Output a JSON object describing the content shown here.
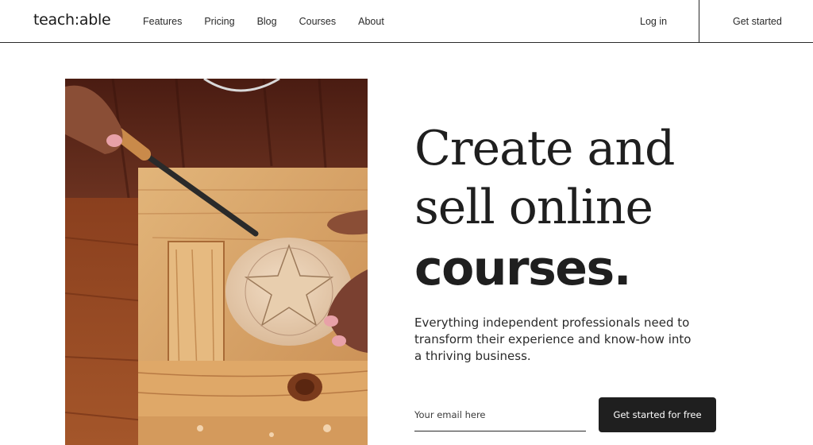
{
  "header": {
    "logo": "teach:able",
    "nav": [
      "Features",
      "Pricing",
      "Blog",
      "Courses",
      "About"
    ],
    "login": "Log in",
    "get_started": "Get started"
  },
  "hero": {
    "headline_line1": "Create and",
    "headline_line2": "sell online",
    "headline_line3": "courses.",
    "subcopy": "Everything independent professionals need to transform their experience and know-how into a thriving business.",
    "email_placeholder": "Your email here",
    "email_value": "",
    "cta_label": "Get started for free",
    "image_subject": "hands-carving-wood-photo"
  },
  "colors": {
    "text": "#1f1f1f",
    "button_bg": "#1f1f1f",
    "button_text": "#ffffff",
    "background": "#ffffff"
  }
}
